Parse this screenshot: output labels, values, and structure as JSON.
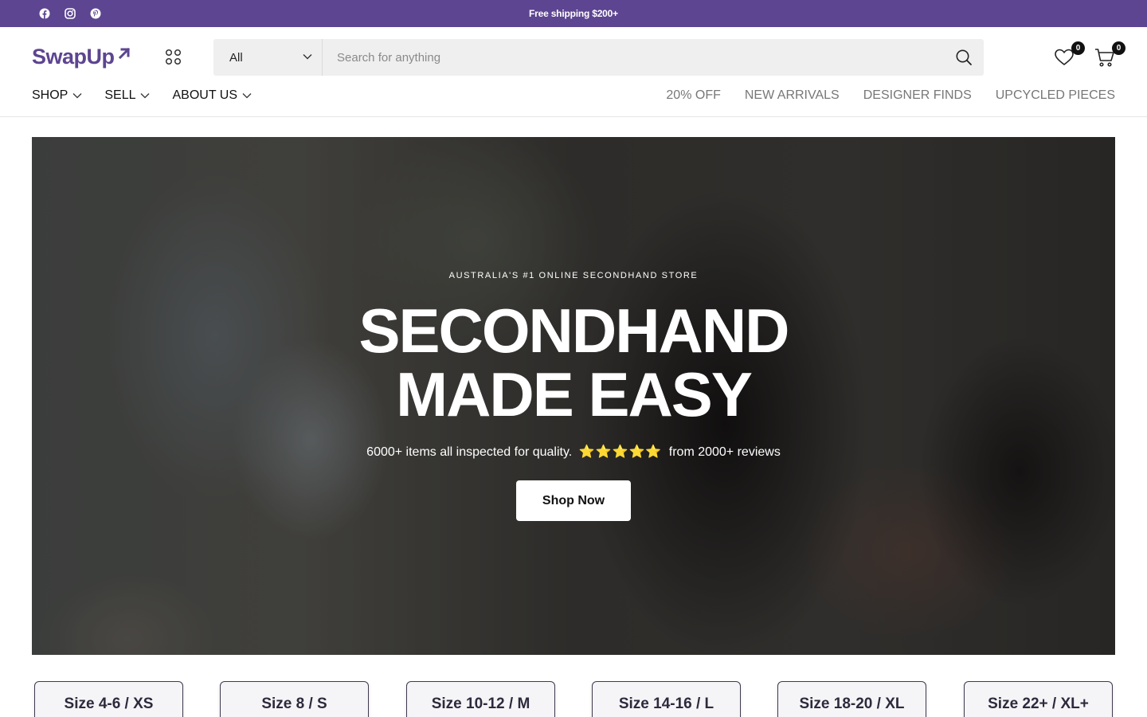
{
  "topbar": {
    "message": "Free shipping $200+",
    "social_icons": [
      "facebook-icon",
      "instagram-icon",
      "pinterest-icon"
    ],
    "background": "#5d4591"
  },
  "header": {
    "logo_text": "SwapUp",
    "brand_color": "#5d4591",
    "search": {
      "category": "All",
      "placeholder": "Search for anything"
    },
    "wishlist_count": "0",
    "cart_count": "0"
  },
  "nav": {
    "left": [
      {
        "label": "SHOP"
      },
      {
        "label": "SELL"
      },
      {
        "label": "ABOUT US"
      }
    ],
    "right": [
      {
        "label": "20% OFF"
      },
      {
        "label": "NEW ARRIVALS"
      },
      {
        "label": "DESIGNER FINDS"
      },
      {
        "label": "UPCYCLED PIECES"
      }
    ]
  },
  "hero": {
    "eyebrow": "AUSTRALIA'S #1 ONLINE SECONDHAND STORE",
    "title_line1": "SECONDHAND",
    "title_line2": "MADE EASY",
    "sub_before": "6000+ items all inspected for quality.",
    "stars": "⭐⭐⭐⭐⭐",
    "rating": 5,
    "sub_after": "from 2000+ reviews",
    "cta": "Shop Now"
  },
  "sizes": [
    {
      "label": "Size 4-6 / XS"
    },
    {
      "label": "Size 8 / S"
    },
    {
      "label": "Size 10-12 / M"
    },
    {
      "label": "Size 14-16 / L"
    },
    {
      "label": "Size 18-20 / XL"
    },
    {
      "label": "Size 22+ / XL+"
    }
  ]
}
